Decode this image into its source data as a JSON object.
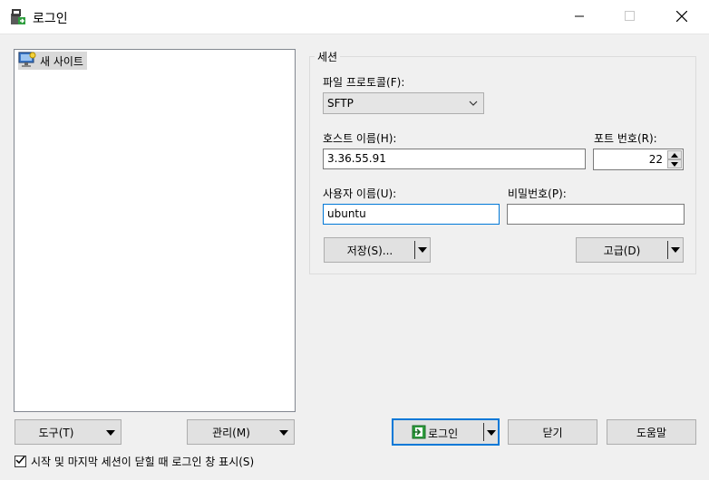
{
  "window": {
    "title": "로그인",
    "icon": "winscp-login-icon",
    "controls": [
      "minimize",
      "maximize",
      "close"
    ]
  },
  "site_tree": {
    "items": [
      {
        "label": "새 사이트",
        "icon": "new-site-monitor-icon"
      }
    ]
  },
  "session": {
    "group_title": "세션",
    "protocol_label": "파일 프로토콜(F):",
    "protocol_value": "SFTP",
    "host_label": "호스트 이름(H):",
    "host_value": "3.36.55.91",
    "port_label": "포트 번호(R):",
    "port_value": "22",
    "user_label": "사용자 이름(U):",
    "user_value": "ubuntu",
    "password_label": "비밀번호(P):",
    "password_value": "",
    "save_label": "저장(S)...",
    "advanced_label": "고급(D)"
  },
  "bottom": {
    "tools_label": "도구(T)",
    "manage_label": "관리(M)",
    "login_label": "로그인",
    "close_label": "닫기",
    "help_label": "도움말",
    "checkbox_label": "시작 및 마지막 세션이 닫힐 때 로그인 창 표시(S)",
    "checkbox_checked": true
  },
  "colors": {
    "background": "#f0f0f0",
    "focus_border": "#0078d7",
    "button_face": "#e1e1e1"
  }
}
